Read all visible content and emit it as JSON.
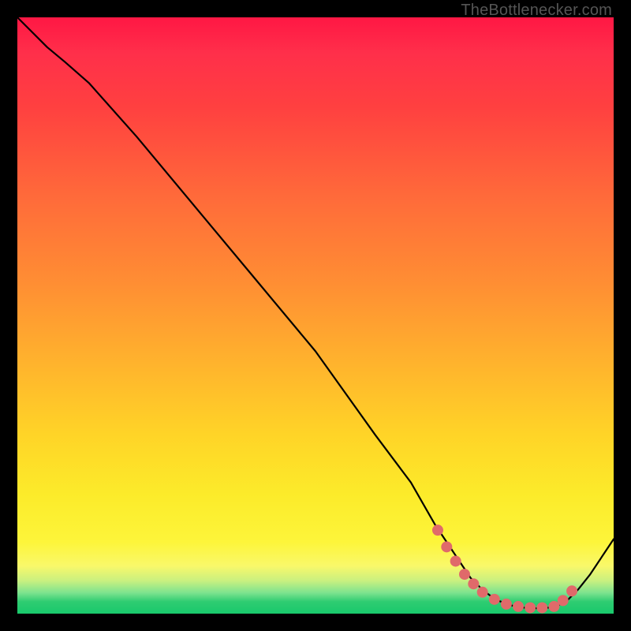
{
  "watermark": "TheBottlenecker.com",
  "chart_data": {
    "type": "line",
    "title": "",
    "xlabel": "",
    "ylabel": "",
    "xlim": [
      0,
      100
    ],
    "ylim": [
      0,
      100
    ],
    "note": "No axes or tick labels are rendered in the image; x/y are in percent of plot width/height with origin at bottom-left. Curve values approximated from pixel positions.",
    "series": [
      {
        "name": "curve",
        "x": [
          0.0,
          2.5,
          5.0,
          8.0,
          12.0,
          20.0,
          30.0,
          40.0,
          50.0,
          60.0,
          66.0,
          70.0,
          72.0,
          74.0,
          76.0,
          78.0,
          80.0,
          82.0,
          84.0,
          86.0,
          88.0,
          90.0,
          92.0,
          94.0,
          96.0,
          98.0,
          100.0
        ],
        "y": [
          100.0,
          97.5,
          95.0,
          92.5,
          89.0,
          80.0,
          68.0,
          56.0,
          44.0,
          30.0,
          22.0,
          15.0,
          12.0,
          9.0,
          6.0,
          4.0,
          2.5,
          1.6,
          1.1,
          0.9,
          0.9,
          1.1,
          2.0,
          4.0,
          6.5,
          9.5,
          12.5
        ]
      }
    ],
    "scatter_points": {
      "name": "markers",
      "x": [
        70.5,
        72.0,
        73.5,
        75.0,
        76.5,
        78.0,
        80.0,
        82.0,
        84.0,
        86.0,
        88.0,
        90.0,
        91.5,
        93.0
      ],
      "y": [
        14.0,
        11.2,
        8.8,
        6.6,
        5.0,
        3.6,
        2.4,
        1.6,
        1.2,
        1.0,
        1.0,
        1.2,
        2.2,
        3.8
      ]
    }
  }
}
